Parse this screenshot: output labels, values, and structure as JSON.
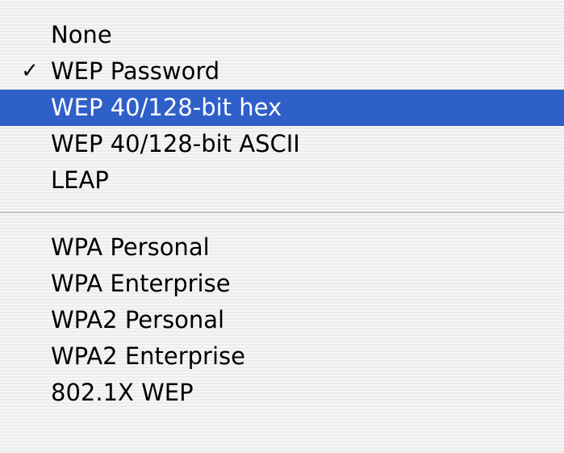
{
  "colors": {
    "highlight": "#2f5fc8",
    "highlight_text": "#ffffff",
    "text": "#000000"
  },
  "menu": {
    "groups": [
      {
        "items": [
          {
            "label": "None",
            "checked": false,
            "highlighted": false
          },
          {
            "label": "WEP Password",
            "checked": true,
            "highlighted": false
          },
          {
            "label": "WEP 40/128-bit hex",
            "checked": false,
            "highlighted": true
          },
          {
            "label": "WEP 40/128-bit ASCII",
            "checked": false,
            "highlighted": false
          },
          {
            "label": "LEAP",
            "checked": false,
            "highlighted": false
          }
        ]
      },
      {
        "items": [
          {
            "label": "WPA Personal",
            "checked": false,
            "highlighted": false
          },
          {
            "label": "WPA Enterprise",
            "checked": false,
            "highlighted": false
          },
          {
            "label": "WPA2 Personal",
            "checked": false,
            "highlighted": false
          },
          {
            "label": "WPA2 Enterprise",
            "checked": false,
            "highlighted": false
          },
          {
            "label": "802.1X WEP",
            "checked": false,
            "highlighted": false
          }
        ]
      }
    ],
    "check_glyph": "✓"
  }
}
